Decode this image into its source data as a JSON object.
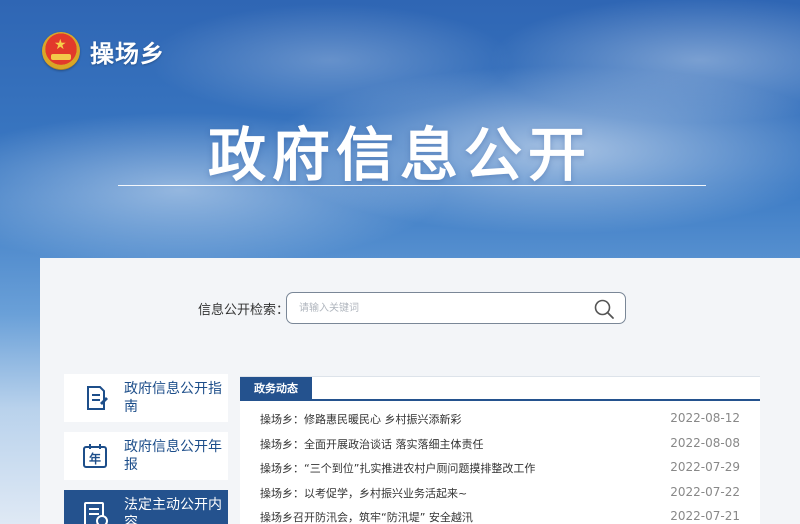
{
  "header": {
    "site_name": "操场乡",
    "emblem_icon": "national-emblem-icon"
  },
  "hero": {
    "title": "政府信息公开"
  },
  "search": {
    "label": "信息公开检索：",
    "placeholder": "请输入关键词",
    "icon": "search-icon"
  },
  "sidebar": {
    "items": [
      {
        "label": "政府信息公开指南",
        "icon": "guide-document-icon",
        "active": false
      },
      {
        "label": "政府信息公开年报",
        "icon": "annual-report-icon",
        "icon_text": "年",
        "active": false
      },
      {
        "label": "法定主动公开内容",
        "icon": "list-document-icon",
        "active": true
      }
    ]
  },
  "main": {
    "tab_label": "政务动态",
    "news": [
      {
        "title": "操场乡：修路惠民暖民心 乡村振兴添新彩",
        "date": "2022-08-12"
      },
      {
        "title": "操场乡：全面开展政治谈话 落实落细主体责任",
        "date": "2022-08-08"
      },
      {
        "title": "操场乡：“三个到位”扎实推进农村户厕问题摸排整改工作",
        "date": "2022-07-29"
      },
      {
        "title": "操场乡：以考促学，乡村振兴业务活起来~",
        "date": "2022-07-22"
      },
      {
        "title": "操场乡召开防汛会，筑牢“防汛堤” 安全越汛",
        "date": "2022-07-21"
      }
    ]
  },
  "colors": {
    "accent": "#24528e",
    "sky": "#2f66b4",
    "panel": "#f3f5f8"
  }
}
